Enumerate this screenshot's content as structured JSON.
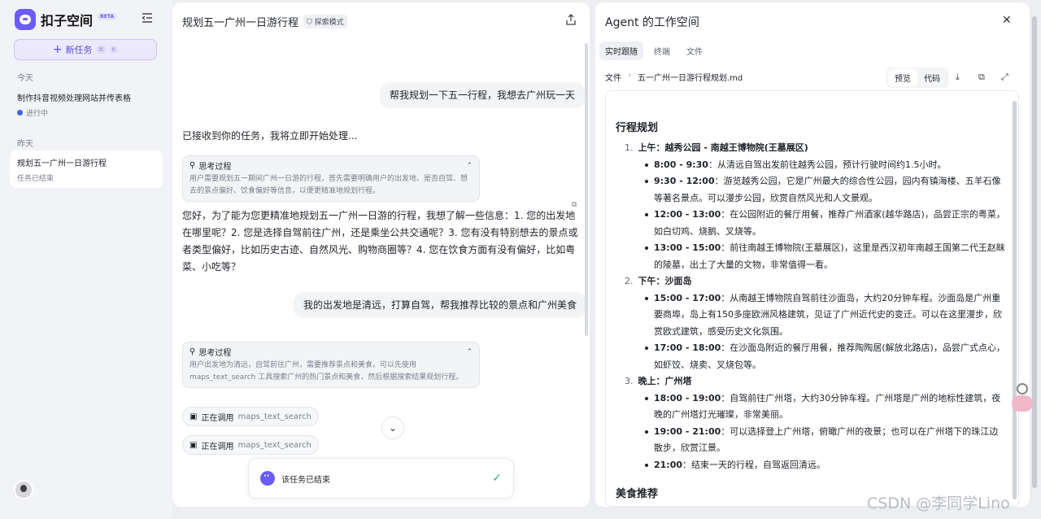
{
  "sidebar": {
    "brand": "扣子空间",
    "beta": "BETA",
    "new_task": "新任务",
    "shortcut": [
      "⌘",
      "K"
    ],
    "today": "今天",
    "yesterday": "昨天",
    "task1": {
      "title": "制作抖音视频处理网站并传表格",
      "status": "进行中"
    },
    "task2": {
      "title": "规划五一广州一日游行程",
      "status": "任务已结束"
    }
  },
  "chat": {
    "title": "规划五一广州一日游行程",
    "mode": "探索模式",
    "user1": "帮我规划一下五一行程，我想去广州玩一天",
    "reply1": "已接收到你的任务，我将立即开始处理...",
    "think_label": "思考过程",
    "think1": "用户需要规划五一期间广州一日游的行程，首先需要明确用户的出发地、是否自驾、想去的景点偏好、饮食偏好等信息，以便更精准地规划行程。",
    "reply2": "您好，为了能为您更精准地规划五一广州一日游的行程，我想了解一些信息：1. 您的出发地在哪里呢？2. 您是选择自驾前往广州，还是乘坐公共交通呢？3. 您有没有特别想去的景点或者类型偏好，比如历史古迹、自然风光、购物商圈等？4. 您在饮食方面有没有偏好，比如粤菜、小吃等？",
    "user2": "我的出发地是清远，打算自驾，帮我推荐比较的景点和广州美食",
    "think2": "用户出发地为清远，自驾前往广州，需要推荐景点和美食。可以先使用maps_text_search 工具搜索广州的热门景点和美食，然后根据搜索结果规划行程。",
    "tool_status": "正在调用",
    "tool_name": "maps_text_search",
    "end_text": "该任务已结束"
  },
  "workspace": {
    "title": "Agent 的工作空间",
    "tabs": [
      "实时跟随",
      "终端",
      "文件"
    ],
    "crumb_root": "文件",
    "crumb_file": "五一广州一日游行程规划.md",
    "preview": "预览",
    "code": "代码",
    "doc_title": "行程规划",
    "sections": [
      {
        "num": "1.",
        "title": "上午：越秀公园 - 南越王博物院(王墓展区)",
        "items": [
          {
            "time": "8:00 - 9:30",
            "text": "：从清远自驾出发前往越秀公园，预计行驶时间约1.5小时。"
          },
          {
            "time": "9:30 - 12:00",
            "text": "：游览越秀公园，它是广州最大的综合性公园，园内有镇海楼、五羊石像等著名景点。可以漫步公园，欣赏自然风光和人文景观。"
          },
          {
            "time": "12:00 - 13:00",
            "text": "：在公园附近的餐厅用餐，推荐广州酒家(越华路店)，品尝正宗的粤菜，如白切鸡、烧鹅、叉烧等。"
          },
          {
            "time": "13:00 - 15:00",
            "text": "：前往南越王博物院(王墓展区)，这里是西汉初年南越王国第二代王赵眜的陵墓，出土了大量的文物，非常值得一看。"
          }
        ]
      },
      {
        "num": "2.",
        "title": "下午：沙面岛",
        "items": [
          {
            "time": "15:00 - 17:00",
            "text": "：从南越王博物院自驾前往沙面岛，大约20分钟车程。沙面岛是广州重要商埠，岛上有150多座欧洲风格建筑，见证了广州近代史的变迁。可以在这里漫步，欣赏欧式建筑，感受历史文化氛围。"
          },
          {
            "time": "17:00 - 18:00",
            "text": "：在沙面岛附近的餐厅用餐，推荐陶陶居(解放北路店)，品尝广式点心，如虾饺、烧卖、叉烧包等。"
          }
        ]
      },
      {
        "num": "3.",
        "title": "晚上：广州塔",
        "items": [
          {
            "time": "18:00 - 19:00",
            "text": "：自驾前往广州塔，大约30分钟车程。广州塔是广州的地标性建筑，夜晚的广州塔灯光璀璨，非常美丽。"
          },
          {
            "time": "19:00 - 21:00",
            "text": "：可以选择登上广州塔，俯瞰广州的夜景；也可以在广州塔下的珠江边散步，欣赏江景。"
          },
          {
            "time": "21:00",
            "text": "：结束一天的行程，自驾返回清远。"
          }
        ]
      }
    ],
    "next_heading": "美食推荐"
  },
  "watermark": "CSDN @李同学Lino"
}
